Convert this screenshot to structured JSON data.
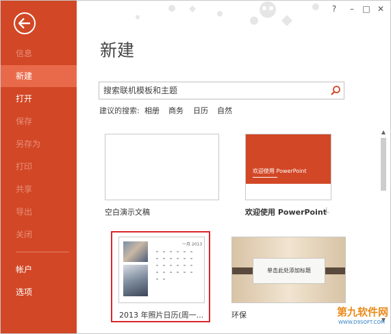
{
  "window": {
    "help_label": "?",
    "minimize_label": "–",
    "maximize_label": "□",
    "close_label": "✕"
  },
  "sidebar": {
    "back_icon": "back-arrow-icon",
    "items": [
      {
        "label": "信息",
        "enabled": false
      },
      {
        "label": "新建",
        "enabled": true,
        "active": true
      },
      {
        "label": "打开",
        "enabled": true
      },
      {
        "label": "保存",
        "enabled": false
      },
      {
        "label": "另存为",
        "enabled": false
      },
      {
        "label": "打印",
        "enabled": false
      },
      {
        "label": "共享",
        "enabled": false
      },
      {
        "label": "导出",
        "enabled": false
      },
      {
        "label": "关闭",
        "enabled": false
      },
      {
        "label": "帐户",
        "enabled": true
      },
      {
        "label": "选项",
        "enabled": true
      }
    ]
  },
  "main": {
    "title": "新建",
    "search": {
      "placeholder": "搜索联机模板和主题"
    },
    "suggested": {
      "label": "建议的搜索:",
      "items": [
        "相册",
        "商务",
        "日历",
        "自然"
      ]
    },
    "templates": [
      {
        "label": "空白演示文稿"
      },
      {
        "label": "欢迎使用 PowerPoint",
        "thumb_text": "欢迎使用 PowerPoint"
      },
      {
        "label": "2013 年照片日历(周一...",
        "thumb_text": "一月 2013"
      },
      {
        "label": "环保",
        "thumb_text": "单击此处添加标题"
      }
    ]
  },
  "watermark": {
    "line1": "第九软件网",
    "line2": "WWW.D9SOFT.COM"
  },
  "colors": {
    "accent": "#d24726",
    "accent_active": "#e96a4a",
    "selection": "#d9252a"
  }
}
